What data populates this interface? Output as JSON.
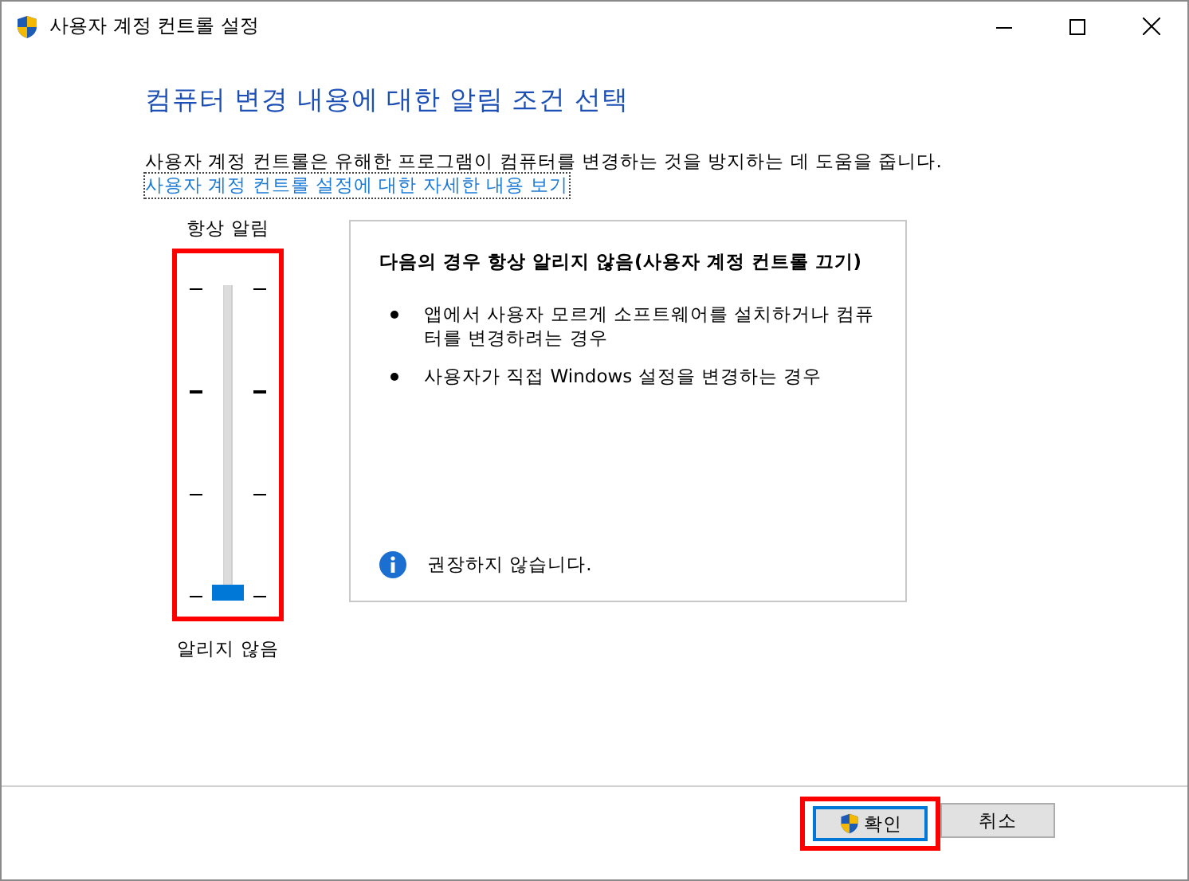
{
  "window": {
    "title": "사용자 계정 컨트롤 설정"
  },
  "heading": "컴퓨터 변경 내용에 대한 알림 조건 선택",
  "description": "사용자 계정 컨트롤은 유해한 프로그램이 컴퓨터를 변경하는 것을 방지하는 데 도움을 줍니다.",
  "link": "사용자 계정 컨트롤 설정에 대한 자세한 내용 보기",
  "slider": {
    "top_label": "항상 알림",
    "bottom_label": "알리지 않음",
    "level": 0
  },
  "panel": {
    "title": "다음의 경우 항상 알리지 않음(사용자 계정 컨트롤 끄기)",
    "bullets": [
      "앱에서 사용자 모르게 소프트웨어를 설치하거나 컴퓨터를 변경하려는 경우",
      "사용자가 직접 Windows 설정을 변경하는 경우"
    ],
    "note": "권장하지 않습니다."
  },
  "buttons": [
    {
      "label": "확인",
      "kind": "primary"
    },
    {
      "label": "취소",
      "kind": "secondary"
    }
  ]
}
